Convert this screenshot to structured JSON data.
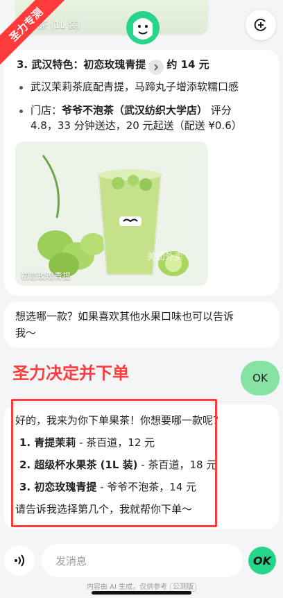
{
  "banner": {
    "text": "圣力专测"
  },
  "top_card": {
    "caption": "水果茶 (1L 装)"
  },
  "message1": {
    "heading_prefix": "3. 武汉特色：初恋玫瑰青提",
    "heading_price": "约 14 元",
    "bullet1": "武汉茉莉茶底配青提，马蹄丸子增添软糯口感",
    "bullet2_prefix": "门店：",
    "bullet2_store": "爷爷不泡茶（武汉纺织大学店）",
    "bullet2_tail1": " 评分",
    "bullet2_line2": "4.8，33 分钟送达，20 元起送（配送 ¥0.6）",
    "image_caption": "初恋玫瑰青提",
    "image_watermark": "美团外卖"
  },
  "message2": {
    "line1": "想选哪一款？如果喜欢其他水果口味也可以告诉",
    "line2": "我～"
  },
  "annotation": {
    "label": "圣力决定并下单"
  },
  "user_message": {
    "text": "OK"
  },
  "message3": {
    "intro": "好的，我来为你下单果茶！你想要哪一款呢？",
    "item1_bold": "1. 青提茉莉",
    "item1_rest": " - 茶百道，12 元",
    "item2_bold": "2. 超级杯水果茶 (1L 装)",
    "item2_rest": " - 茶百道，18 元",
    "item3_bold": "3. 初恋玫瑰青提",
    "item3_rest": " - 爷爷不泡茶，14 元",
    "outro": "请告诉我选择第几个，我就帮你下单～"
  },
  "composer": {
    "placeholder": "发消息",
    "send_badge": "OK"
  },
  "footer": {
    "text": "内容由 AI 生成，仅供参考",
    "tag": "公测版"
  },
  "colors": {
    "accent_red": "#ff3b3b",
    "user_bubble": "#86e3a4",
    "brand_green": "#27d58a"
  }
}
